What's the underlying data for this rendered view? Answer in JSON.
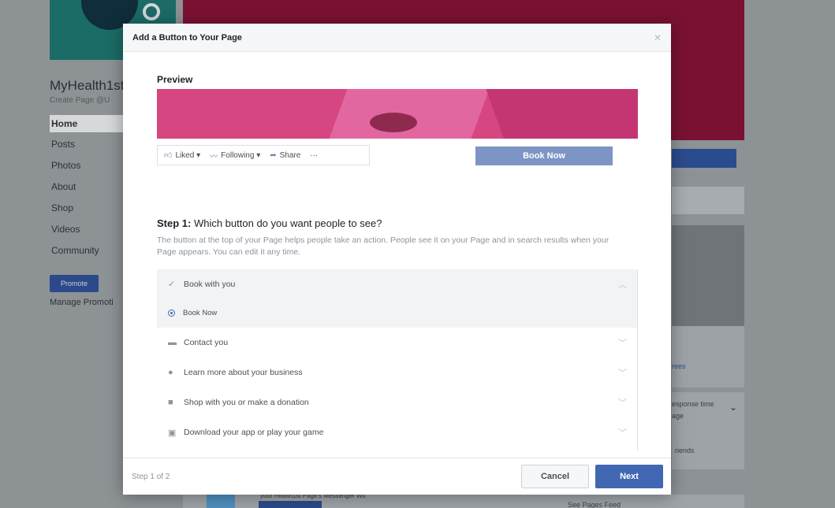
{
  "background_page": {
    "page_name": "MyHealth1st",
    "page_handle": "Create Page @U",
    "nav": [
      "Home",
      "Posts",
      "Photos",
      "About",
      "Shop",
      "Videos",
      "Community"
    ],
    "promote_label": "Promote",
    "manage_label": "Manage Promoti",
    "right_link": "rees",
    "response_text": "esponse time",
    "response_sub": "age",
    "friends_text": "riends",
    "bottom_text": "your Health1st Page's Messenger Wit",
    "see_feed": "See Pages Feed"
  },
  "dialog": {
    "title": "Add a Button to Your Page",
    "close_icon": "close-icon",
    "preview_label": "Preview",
    "actions": [
      {
        "icon": "thumbs-up-icon",
        "label": "Liked ▾"
      },
      {
        "icon": "rss-icon",
        "label": "Following ▾"
      },
      {
        "icon": "share-icon",
        "label": "Share"
      },
      {
        "icon": "more-icon",
        "label": "···"
      }
    ],
    "book_now_label": "Book Now",
    "step_prefix": "Step 1:",
    "step_question": " Which button do you want people to see?",
    "step_description": "The button at the top of your Page helps people take an action. People see it on your Page and in search results when your Page appears. You can edit it any time.",
    "options": [
      {
        "icon": "check-icon",
        "label": "Book with you",
        "state": "expanded"
      },
      {
        "icon": "radio-icon",
        "label": "Book Now",
        "state": "selected-sub"
      },
      {
        "icon": "chat-icon",
        "label": "Contact you",
        "state": "collapsed"
      },
      {
        "icon": "info-icon",
        "label": "Learn more about your business",
        "state": "collapsed"
      },
      {
        "icon": "bag-icon",
        "label": "Shop with you or make a donation",
        "state": "collapsed"
      },
      {
        "icon": "app-icon",
        "label": "Download your app or play your game",
        "state": "collapsed"
      }
    ],
    "step_count": "Step 1 of 2",
    "cancel_label": "Cancel",
    "next_label": "Next"
  },
  "colors": {
    "primary": "#4267b2",
    "cover_pink": "#d64680",
    "overlay": "#8d9295"
  }
}
